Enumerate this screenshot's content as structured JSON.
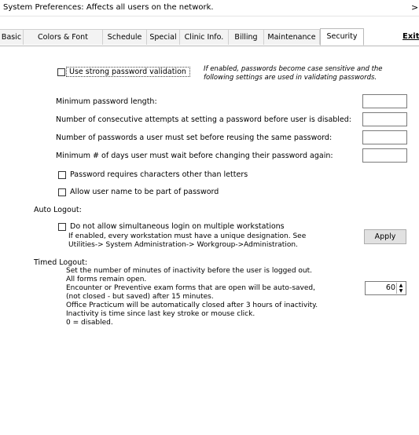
{
  "window": {
    "title": "System Preferences: Affects all users on the network.",
    "close": ">"
  },
  "tabs": [
    "Basic",
    "Colors & Font",
    "Schedule",
    "Special",
    "Clinic Info.",
    "Billing",
    "Maintenance",
    "Security"
  ],
  "active_tab": "Security",
  "exit_label": "Exit",
  "security": {
    "strong_password_label": "Use strong password validation",
    "strong_password_note": [
      "If enabled, passwords become case sensitive and the",
      "following settings are used in validating passwords."
    ],
    "min_length_label": "Minimum password length:",
    "attempts_label": "Number of consecutive attempts at setting a password before user is disabled:",
    "reuse_label": "Number of passwords a user must set before reusing the same password:",
    "min_days_label": "Minimum # of days user must wait before changing their password again:",
    "require_nonletters_label": "Password requires characters other than letters",
    "allow_username_label": "Allow user name to be part of password"
  },
  "auto_logout": {
    "heading": "Auto Logout:",
    "no_simultaneous_label": "Do not allow simultaneous login on multiple workstations",
    "note": [
      "If enabled, every workstation must have a unique designation. See",
      "Utilities-> System Administration-> Workgroup->Administration."
    ],
    "apply_label": "Apply"
  },
  "timed_logout": {
    "heading": "Timed Logout:",
    "description": [
      "Set the number of minutes of inactivity before the user is logged out.",
      "All forms remain open.",
      "Encounter or Preventive exam forms that are open will be auto-saved,",
      "(not closed - but saved) after 15 minutes.",
      "Office Practicum will be automatically closed after 3 hours of inactivity.",
      "Inactivity is time since last key stroke or mouse click.",
      "0 = disabled."
    ],
    "minutes_value": "60"
  },
  "icons": {
    "spin_up": "up-arrow-icon",
    "spin_down": "down-arrow-icon"
  }
}
